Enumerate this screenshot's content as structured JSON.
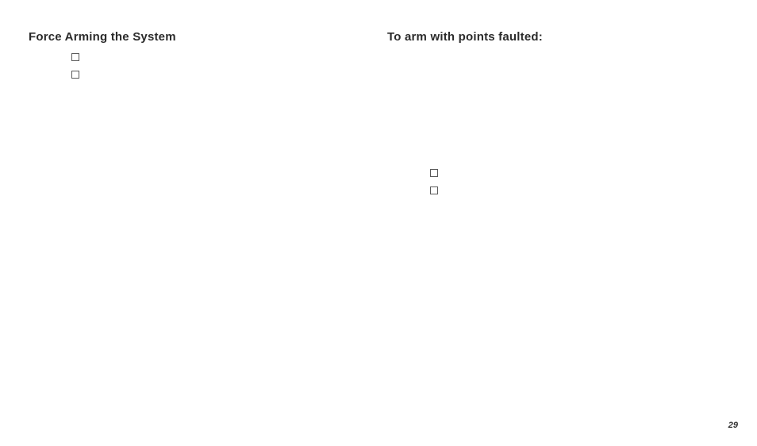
{
  "left": {
    "heading": "Force Arming the System",
    "checkboxes": [
      {
        "checked": false
      },
      {
        "checked": false
      }
    ]
  },
  "right": {
    "heading": "To arm with points faulted:",
    "checkboxes": [
      {
        "checked": false
      },
      {
        "checked": false
      }
    ]
  },
  "page_number": "29"
}
